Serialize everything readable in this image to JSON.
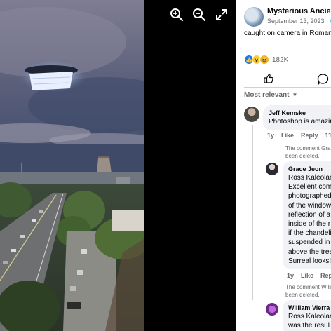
{
  "post": {
    "author": "Mysterious Ancient",
    "date": "September 13, 2023",
    "caption": "caught on camera in Romani",
    "reaction_count": "182K"
  },
  "viewer_tools": [
    "zoom-in-icon",
    "zoom-out-icon",
    "fullscreen-icon"
  ],
  "sort_label": "Most relevant",
  "comments": [
    {
      "name": "Jeff Kemske",
      "text": "Photoshop is amazing",
      "meta": [
        "1y",
        "Like",
        "Reply",
        "11"
      ],
      "deleted_notice": [
        "The comment Gra",
        "been deleted."
      ]
    },
    {
      "name": "Grace Jeon",
      "lines": [
        "Ross Kaleolani",
        "Excellent comm",
        "photographed",
        "of the window",
        "reflection of a",
        "inside of the r",
        "if the chandeli",
        "suspended in t",
        "above the tree",
        "Surreal looks!"
      ],
      "meta": [
        "1y",
        "Like",
        "Reply"
      ],
      "deleted_notice": [
        "The comment Willi",
        "been deleted."
      ]
    },
    {
      "name": "William Vierra",
      "lines": [
        "Ross Kaleolani",
        "was the resul"
      ]
    }
  ]
}
